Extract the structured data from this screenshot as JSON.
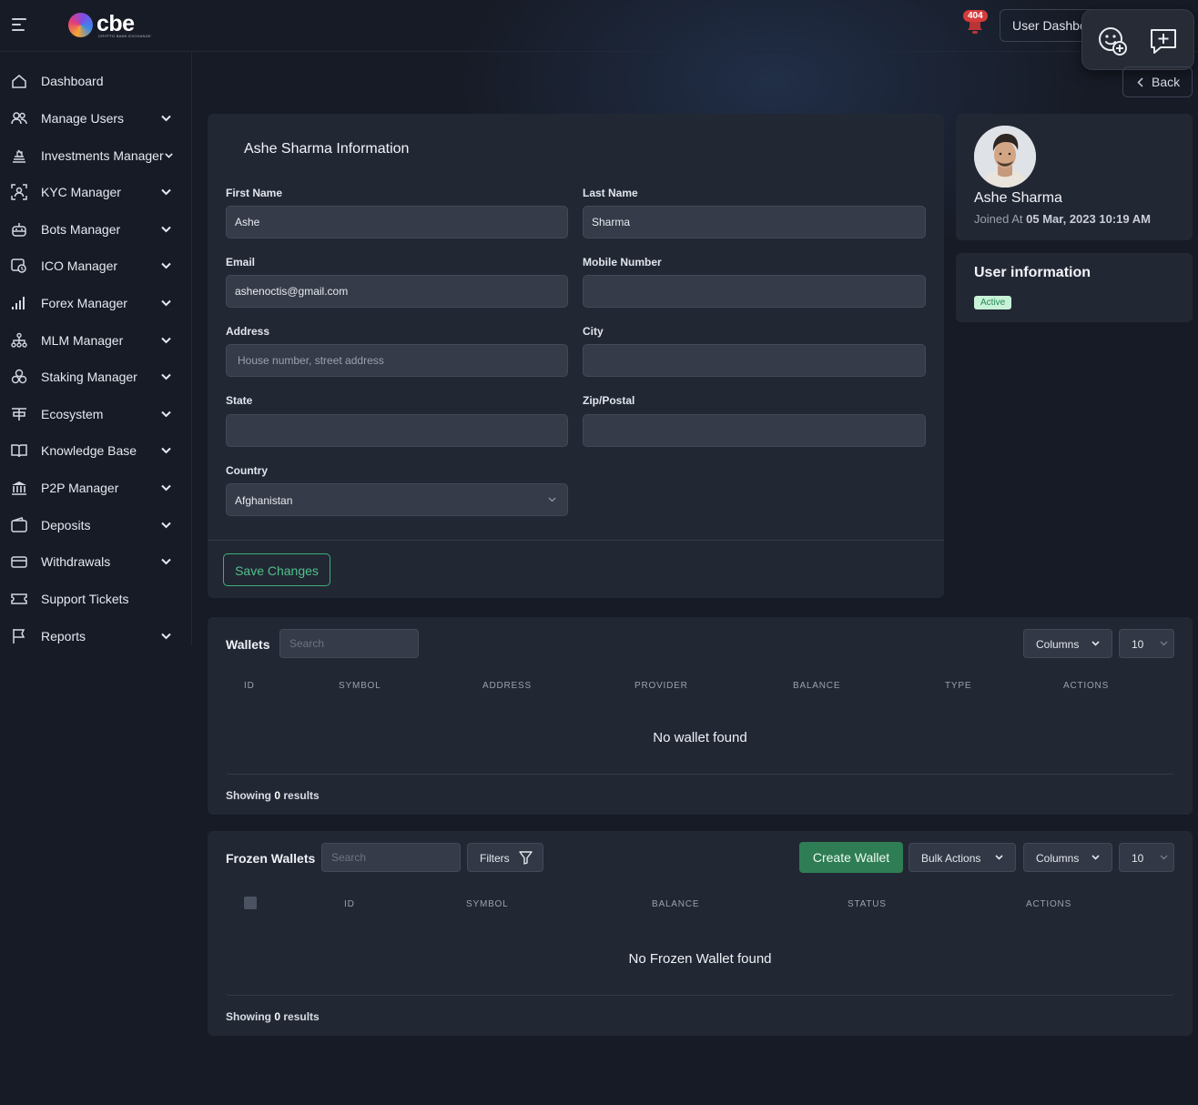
{
  "brand": {
    "name": "cbe",
    "tagline": "CRYPTO BANK EXCHANGE"
  },
  "header": {
    "notification_count": "404",
    "user_dashboard_label": "User Dashboard",
    "back_label": "Back"
  },
  "sidebar": {
    "items": [
      {
        "label": "Dashboard",
        "icon": "home-icon",
        "has_submenu": false
      },
      {
        "label": "Manage Users",
        "icon": "users-icon",
        "has_submenu": true
      },
      {
        "label": "Investments Manager",
        "icon": "investments-icon",
        "has_submenu": true
      },
      {
        "label": "KYC Manager",
        "icon": "kyc-icon",
        "has_submenu": true
      },
      {
        "label": "Bots Manager",
        "icon": "robot-icon",
        "has_submenu": true
      },
      {
        "label": "ICO Manager",
        "icon": "ico-icon",
        "has_submenu": true
      },
      {
        "label": "Forex Manager",
        "icon": "chart-bars-icon",
        "has_submenu": true
      },
      {
        "label": "MLM Manager",
        "icon": "hierarchy-icon",
        "has_submenu": true
      },
      {
        "label": "Staking Manager",
        "icon": "coins-stack-icon",
        "has_submenu": true
      },
      {
        "label": "Ecosystem",
        "icon": "ecosystem-icon",
        "has_submenu": true
      },
      {
        "label": "Knowledge Base",
        "icon": "book-icon",
        "has_submenu": true
      },
      {
        "label": "P2P Manager",
        "icon": "bank-icon",
        "has_submenu": true
      },
      {
        "label": "Deposits",
        "icon": "wallet-icon",
        "has_submenu": true
      },
      {
        "label": "Withdrawals",
        "icon": "withdraw-icon",
        "has_submenu": true
      },
      {
        "label": "Support Tickets",
        "icon": "ticket-icon",
        "has_submenu": false
      },
      {
        "label": "Reports",
        "icon": "flag-icon",
        "has_submenu": true
      }
    ]
  },
  "user_form": {
    "title": "Ashe Sharma Information",
    "first_name": {
      "label": "First Name",
      "value": "Ashe"
    },
    "last_name": {
      "label": "Last Name",
      "value": "Sharma"
    },
    "email": {
      "label": "Email",
      "value": "ashenoctis@gmail.com"
    },
    "mobile": {
      "label": "Mobile Number",
      "value": ""
    },
    "address": {
      "label": "Address",
      "value": "",
      "placeholder": "House number, street address"
    },
    "city": {
      "label": "City",
      "value": ""
    },
    "state": {
      "label": "State",
      "value": ""
    },
    "zip": {
      "label": "Zip/Postal",
      "value": ""
    },
    "country": {
      "label": "Country",
      "value": "Afghanistan"
    },
    "save_label": "Save Changes"
  },
  "profile": {
    "name": "Ashe Sharma",
    "joined_prefix": "Joined At",
    "joined_date": "05 Mar, 2023 10:19 AM"
  },
  "user_info": {
    "title": "User information",
    "status": "Active"
  },
  "wallets": {
    "title": "Wallets",
    "search_placeholder": "Search",
    "columns_label": "Columns",
    "per_page": "10",
    "headers": [
      "ID",
      "SYMBOL",
      "ADDRESS",
      "PROVIDER",
      "BALANCE",
      "TYPE",
      "ACTIONS"
    ],
    "empty_message": "No wallet found",
    "showing_prefix": "Showing",
    "showing_count": "0",
    "showing_suffix": "results"
  },
  "frozen_wallets": {
    "title": "Frozen Wallets",
    "search_placeholder": "Search",
    "filters_label": "Filters",
    "create_label": "Create Wallet",
    "bulk_label": "Bulk Actions",
    "columns_label": "Columns",
    "per_page": "10",
    "headers": [
      "ID",
      "SYMBOL",
      "BALANCE",
      "STATUS",
      "ACTIONS"
    ],
    "empty_message": "No Frozen Wallet found",
    "showing_prefix": "Showing",
    "showing_count": "0",
    "showing_suffix": "results"
  },
  "colors": {
    "background": "#171b26",
    "card": "#222734",
    "accent_green": "#4fc189",
    "create_button": "#2f7d55",
    "badge_red": "#d63b3b"
  }
}
